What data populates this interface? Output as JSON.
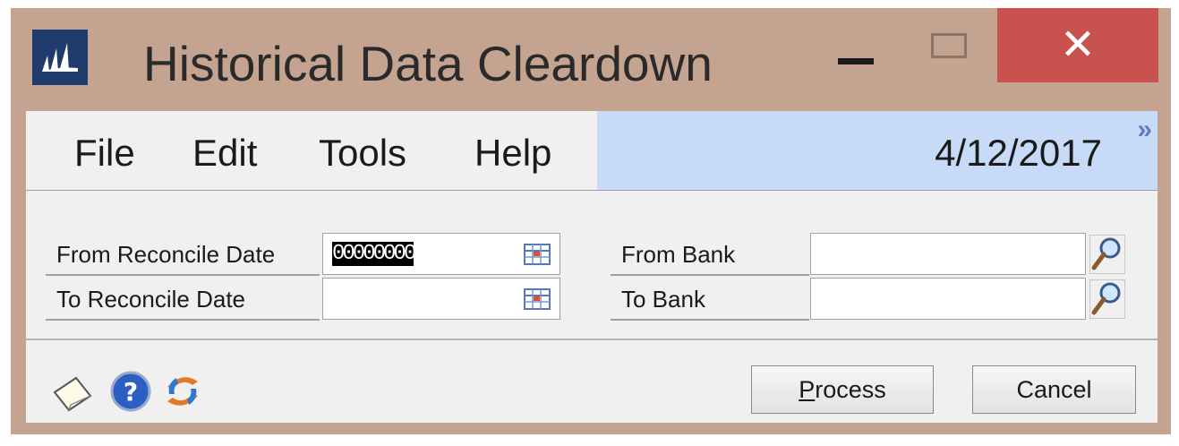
{
  "window": {
    "title": "Historical Data Cleardown",
    "close_glyph": "✕",
    "icons": {
      "app": "dynamics-logo-icon",
      "minimize": "minimize-icon",
      "maximize": "maximize-icon",
      "close": "close-icon"
    },
    "colors": {
      "frame": "#c4a490",
      "close": "#c9524e",
      "date_bar": "#c7daf7",
      "app_icon": "#1f3a6d"
    }
  },
  "menubar": {
    "items": [
      "File",
      "Edit",
      "Tools",
      "Help"
    ],
    "date": "4/12/2017",
    "expand_glyph": "»"
  },
  "form": {
    "from_reconcile_date": {
      "label": "From Reconcile Date",
      "value": "00000000",
      "icon": "calendar-icon"
    },
    "to_reconcile_date": {
      "label": "To Reconcile Date",
      "value": "",
      "icon": "calendar-icon"
    },
    "from_bank": {
      "label": "From Bank",
      "value": "",
      "icon": "lookup-icon"
    },
    "to_bank": {
      "label": "To Bank",
      "value": "",
      "icon": "lookup-icon"
    }
  },
  "footer": {
    "icons": [
      "note-icon",
      "help-icon",
      "refresh-icon"
    ],
    "process_label": "Process",
    "process_mnemonic": "P",
    "process_rest": "rocess",
    "cancel_label": "Cancel"
  }
}
